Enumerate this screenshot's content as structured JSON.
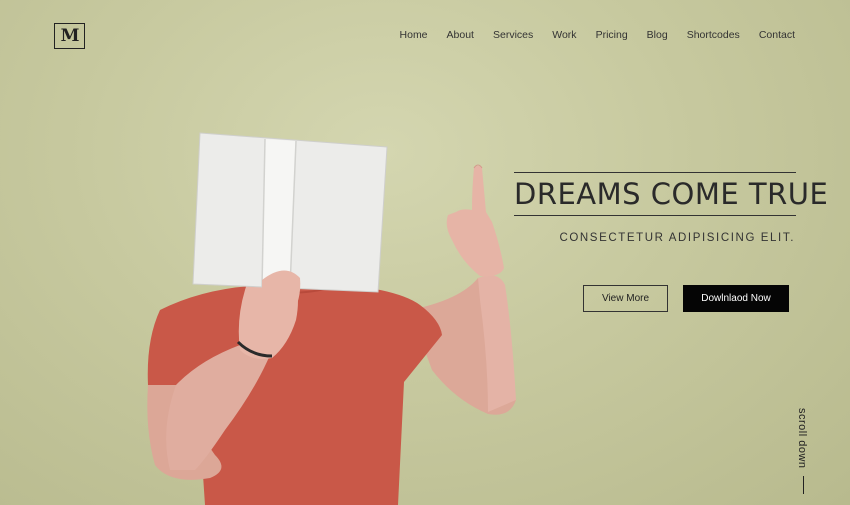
{
  "header": {
    "logo_text": "M",
    "nav": [
      "Home",
      "About",
      "Services",
      "Work",
      "Pricing",
      "Blog",
      "Shortcodes",
      "Contact"
    ]
  },
  "hero": {
    "headline": "DREAMS COME TRUE",
    "subline": "CONSECTETUR ADIPISICING ELIT.",
    "view_more_label": "View More",
    "download_label": "Dowlnlaod Now"
  },
  "scroll": {
    "label": "scroll down"
  },
  "colors": {
    "background": "#c7c99f",
    "shirt": "#cb5a4a",
    "skin": "#e2ada0",
    "book": "#ededeb",
    "button_dark": "#050505"
  }
}
